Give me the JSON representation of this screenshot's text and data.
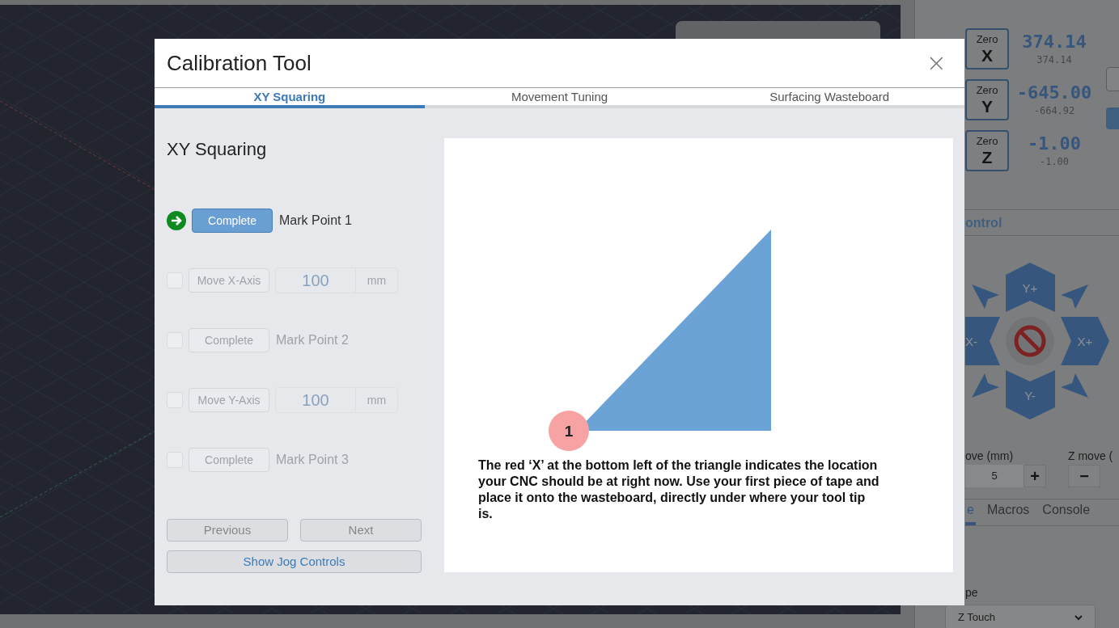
{
  "dro": {
    "axes": [
      {
        "zero": "Zero",
        "axis": "X",
        "work": "374.14",
        "machine": "374.14"
      },
      {
        "zero": "Zero",
        "axis": "Y",
        "work": "-645.00",
        "machine": "-664.92"
      },
      {
        "zero": "Zero",
        "axis": "Z",
        "work": "-1.00",
        "machine": "-1.00"
      }
    ]
  },
  "jog": {
    "header": "ontrol",
    "y_plus": "Y+",
    "x_minus": "X-",
    "x_plus": "X+",
    "y_minus": "Y-"
  },
  "moves": {
    "xy_label": "ove (mm)",
    "xy_value": "5",
    "plus": "+",
    "z_label": "Z move (",
    "minus": "−"
  },
  "tool_tabs": [
    {
      "label": "e",
      "selected": true
    },
    {
      "label": "Macros",
      "selected": false
    },
    {
      "label": "Console",
      "selected": false
    }
  ],
  "probe": {
    "label": "pe",
    "select": "Z Touch"
  },
  "modal": {
    "title": "Calibration Tool",
    "close": "×",
    "tabs": [
      {
        "label": "XY Squaring",
        "selected": true
      },
      {
        "label": "Movement Tuning",
        "selected": false
      },
      {
        "label": "Surfacing Wasteboard",
        "selected": false
      }
    ],
    "heading": "XY Squaring",
    "steps": [
      {
        "kind": "mark",
        "current": true,
        "disabled": false,
        "button": "Complete",
        "label": "Mark Point 1"
      },
      {
        "kind": "move",
        "current": false,
        "disabled": true,
        "button": "Move X-Axis",
        "value": "100",
        "unit": "mm"
      },
      {
        "kind": "mark",
        "current": false,
        "disabled": true,
        "button": "Complete",
        "label": "Mark Point 2"
      },
      {
        "kind": "move",
        "current": false,
        "disabled": true,
        "button": "Move Y-Axis",
        "value": "100",
        "unit": "mm"
      },
      {
        "kind": "mark",
        "current": false,
        "disabled": true,
        "button": "Complete",
        "label": "Mark Point 3"
      }
    ],
    "previous": "Previous",
    "next": "Next",
    "jog_button": "Show Jog Controls",
    "marker": "1",
    "caption": "The red ‘X’ at the bottom left of the triangle indicates the location your CNC should be at right now. Use your first piece of tape and place it onto the wasteboard, directly under where your tool tip is."
  }
}
